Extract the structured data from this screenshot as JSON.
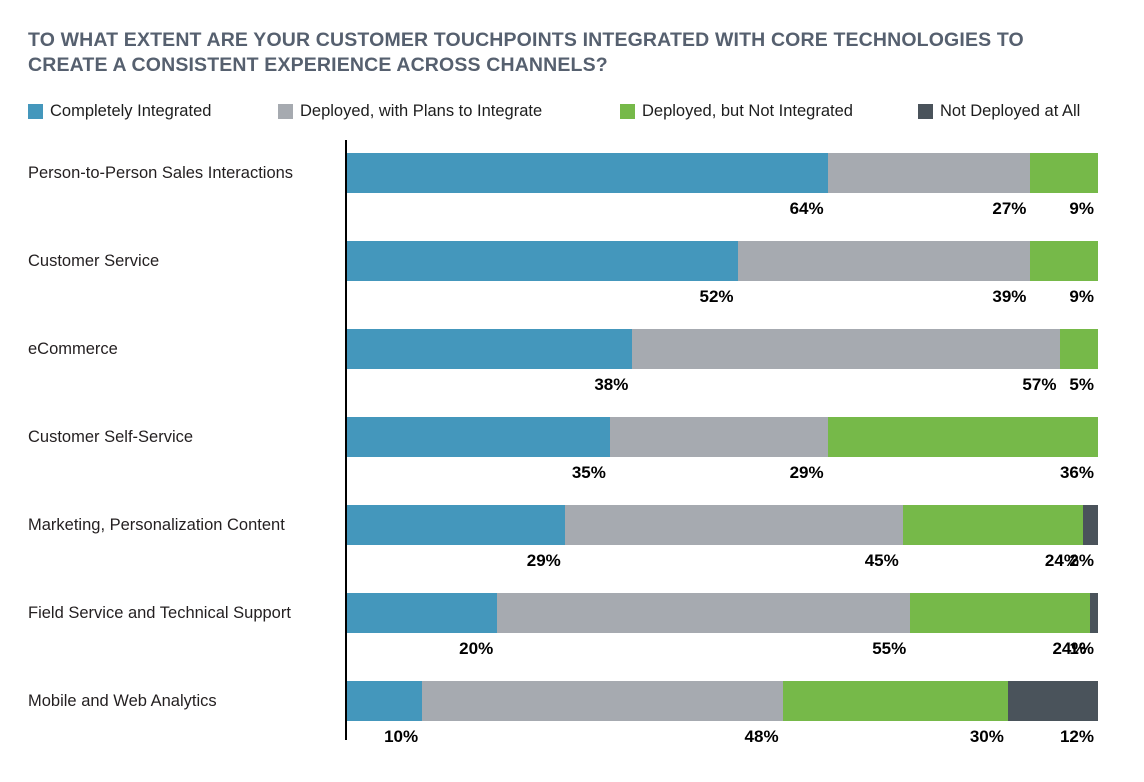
{
  "title": {
    "line1": "TO WHAT EXTENT ARE YOUR CUSTOMER TOUCHPOINTS INTEGRATED WITH CORE TECHNOLOGIES TO",
    "line2": "CREATE A CONSISTENT EXPERIENCE ACROSS CHANNELS?"
  },
  "legend": [
    {
      "label": "Completely Integrated",
      "color": "#4497bc",
      "left": 0
    },
    {
      "label": "Deployed, with Plans to Integrate",
      "color": "#a6aab0",
      "left": 250
    },
    {
      "label": "Deployed, but Not Integrated",
      "color": "#76b949",
      "left": 592
    },
    {
      "label": "Not Deployed at All",
      "color": "#4a535b",
      "left": 890
    }
  ],
  "colors": {
    "completely_integrated": "#4497bc",
    "deployed_with_plans": "#a6aab0",
    "deployed_not_integrated": "#76b949",
    "not_deployed": "#4a535b",
    "title": "#56606f",
    "axis": "#000000",
    "label": "#231f20",
    "value": "#000000",
    "background": "#ffffff"
  },
  "chart_data": {
    "type": "bar",
    "orientation": "horizontal",
    "stacked": true,
    "normalized_percent": true,
    "title": "TO WHAT EXTENT ARE YOUR CUSTOMER TOUCHPOINTS INTEGRATED WITH CORE TECHNOLOGIES TO CREATE A CONSISTENT EXPERIENCE ACROSS CHANNELS?",
    "xlabel": "",
    "ylabel": "",
    "xlim": [
      0,
      100
    ],
    "grid": false,
    "legend_position": "top",
    "categories": [
      "Person-to-Person Sales Interactions",
      "Customer Service",
      "eCommerce",
      "Customer Self-Service",
      "Marketing, Personalization Content",
      "Field Service and Technical Support",
      "Mobile and Web Analytics"
    ],
    "series": [
      {
        "name": "Completely Integrated",
        "color": "#4497bc",
        "values": [
          64,
          52,
          38,
          35,
          29,
          20,
          10
        ]
      },
      {
        "name": "Deployed, with Plans to Integrate",
        "color": "#a6aab0",
        "values": [
          27,
          39,
          57,
          29,
          45,
          55,
          48
        ]
      },
      {
        "name": "Deployed, but Not Integrated",
        "color": "#76b949",
        "values": [
          9,
          9,
          5,
          36,
          24,
          24,
          30
        ]
      },
      {
        "name": "Not Deployed at All",
        "color": "#4a535b",
        "values": [
          0,
          0,
          0,
          0,
          2,
          1,
          12
        ]
      }
    ],
    "value_labels": [
      [
        "64%",
        "27%",
        "9%",
        ""
      ],
      [
        "52%",
        "39%",
        "9%",
        ""
      ],
      [
        "38%",
        "57%",
        "5%",
        ""
      ],
      [
        "35%",
        "29%",
        "36%",
        ""
      ],
      [
        "29%",
        "45%",
        "24%",
        "2%"
      ],
      [
        "20%",
        "55%",
        "24%",
        "1%"
      ],
      [
        "10%",
        "48%",
        "30%",
        "12%"
      ]
    ]
  }
}
